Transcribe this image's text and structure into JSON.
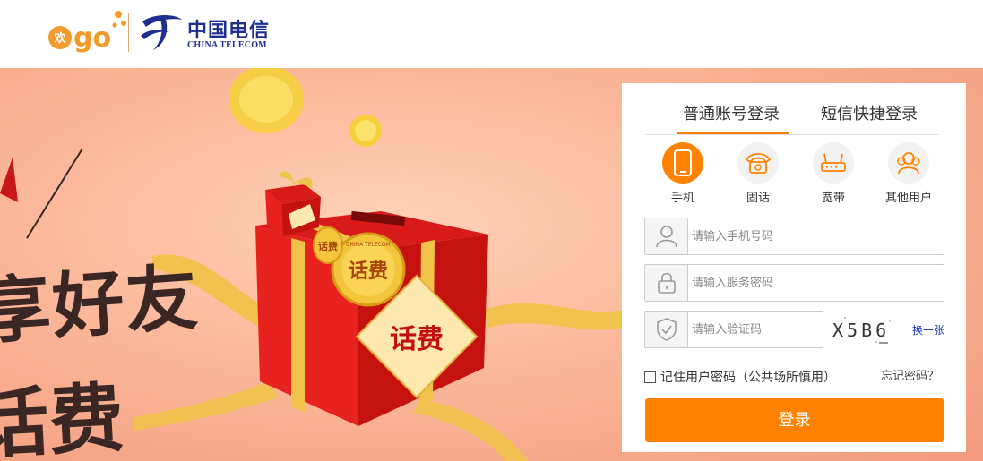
{
  "header": {
    "go_logo_small": "欢",
    "go_logo_text": "go",
    "telecom_cn": "中国电信",
    "telecom_en": "CHINA TELECOM"
  },
  "banner": {
    "calligraphy_line1": "享好友",
    "calligraphy_line2": "话费",
    "box_label": "话费",
    "coin_label": "话费",
    "coin_ring": "CHINA TELECOM",
    "small_coin_label": "话费"
  },
  "login": {
    "tabs": [
      {
        "label": "普通账号登录",
        "active": true
      },
      {
        "label": "短信快捷登录",
        "active": false
      }
    ],
    "types": [
      {
        "label": "手机",
        "icon": "mobile-phone-icon",
        "active": true
      },
      {
        "label": "固话",
        "icon": "landline-phone-icon",
        "active": false
      },
      {
        "label": "宽带",
        "icon": "router-icon",
        "active": false
      },
      {
        "label": "其他用户",
        "icon": "users-icon",
        "active": false
      }
    ],
    "phone_placeholder": "请输入手机号码",
    "password_placeholder": "请输入服务密码",
    "code_placeholder": "请输入验证码",
    "captcha_text": "X5B6",
    "refresh_label": "换一张",
    "remember_label": "记住用户密码（公共场所慎用）",
    "forgot_label": "忘记密码？",
    "submit_label": "登录"
  },
  "colors": {
    "accent": "#ff8300",
    "brand_blue": "#1e2f8f",
    "link_blue": "#1e3ab8"
  }
}
